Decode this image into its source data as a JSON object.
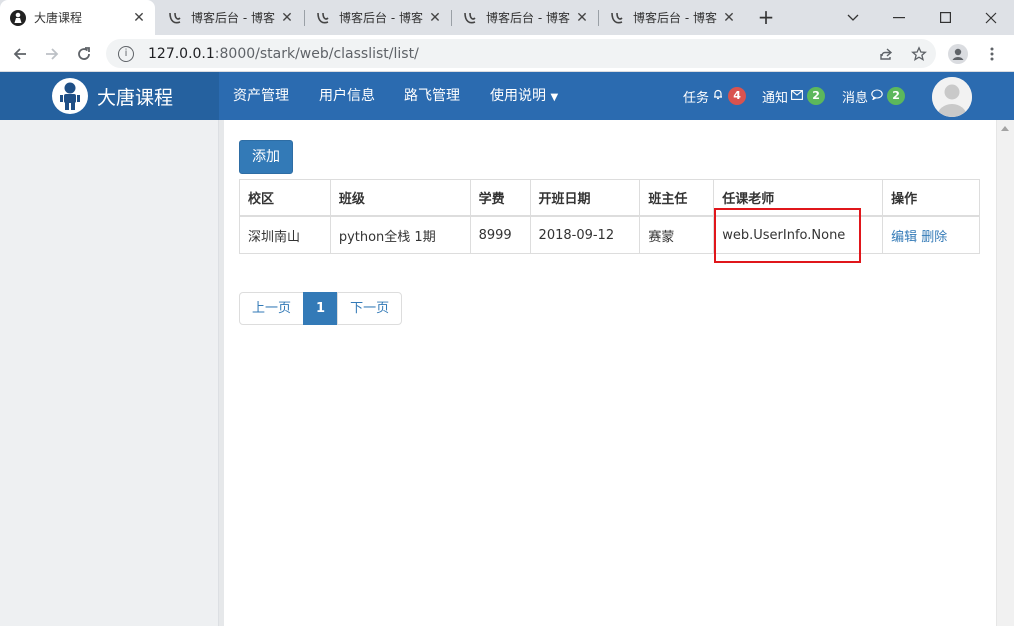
{
  "browser": {
    "tabs": [
      {
        "title": "大唐课程",
        "active": true,
        "icon": "user-silhouette-icon"
      },
      {
        "title": "博客后台 - 博客",
        "active": false,
        "icon": "cnblogs-icon"
      },
      {
        "title": "博客后台 - 博客",
        "active": false,
        "icon": "cnblogs-icon"
      },
      {
        "title": "博客后台 - 博客",
        "active": false,
        "icon": "cnblogs-icon"
      },
      {
        "title": "博客后台 - 博客",
        "active": false,
        "icon": "cnblogs-icon"
      }
    ],
    "url_host": "127.0.0.1",
    "url_rest": ":8000/stark/web/classlist/list/"
  },
  "app": {
    "brand": "大唐课程",
    "menu": [
      "资产管理",
      "用户信息",
      "路飞管理",
      "使用说明"
    ],
    "right_menu": [
      {
        "label": "任务",
        "icon": "bell-icon",
        "count": "4",
        "color": "#d9534f"
      },
      {
        "label": "通知",
        "icon": "envelope-icon",
        "count": "2",
        "color": "#5cb85c"
      },
      {
        "label": "消息",
        "icon": "comment-icon",
        "count": "2",
        "color": "#5cb85c"
      }
    ]
  },
  "main": {
    "add_label": "添加",
    "columns": [
      "校区",
      "班级",
      "学费",
      "开班日期",
      "班主任",
      "任课老师",
      "操作"
    ],
    "rows": [
      {
        "school": "深圳南山",
        "class": "python全栈 1期",
        "fee": "8999",
        "start_date": "2018-09-12",
        "head_teacher": "赛蒙",
        "teachers": "web.UserInfo.None",
        "edit": "编辑",
        "delete": "删除"
      }
    ],
    "pager": {
      "prev": "上一页",
      "current": "1",
      "next": "下一页"
    }
  },
  "colors": {
    "nav": "#2b6bb0",
    "primary": "#337ab7",
    "highlight": "#e0161b"
  }
}
